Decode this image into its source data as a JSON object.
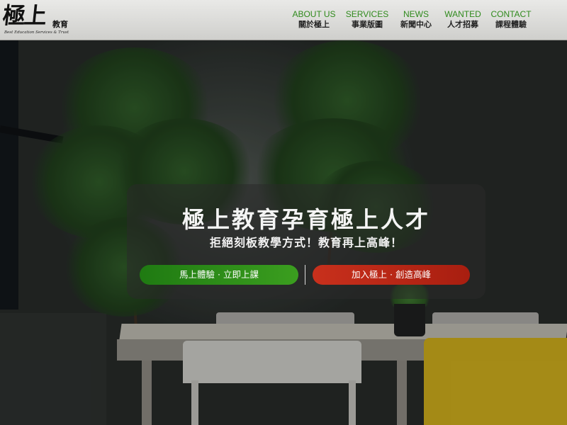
{
  "brand": {
    "logo_text": "極上",
    "logo_sub": "教育",
    "tagline": "Best Education Services & Trust"
  },
  "nav": {
    "items": [
      {
        "en": "ABOUT US",
        "zh": "關於極上"
      },
      {
        "en": "SERVICES",
        "zh": "事業版圖"
      },
      {
        "en": "NEWS",
        "zh": "新聞中心"
      },
      {
        "en": "WANTED",
        "zh": "人才招募"
      },
      {
        "en": "CONTACT",
        "zh": "課程體驗"
      }
    ]
  },
  "hero": {
    "headline": "極上教育孕育極上人才",
    "subheadline": "拒絕刻板教學方式！教育再上高峰！",
    "cta_primary": "馬上體驗 ·  立即上課",
    "cta_secondary": "加入極上 ·  創造高峰"
  },
  "colors": {
    "nav_accent": "#2f8a1c",
    "cta_primary": "#2f8e19",
    "cta_secondary": "#b7281a"
  }
}
